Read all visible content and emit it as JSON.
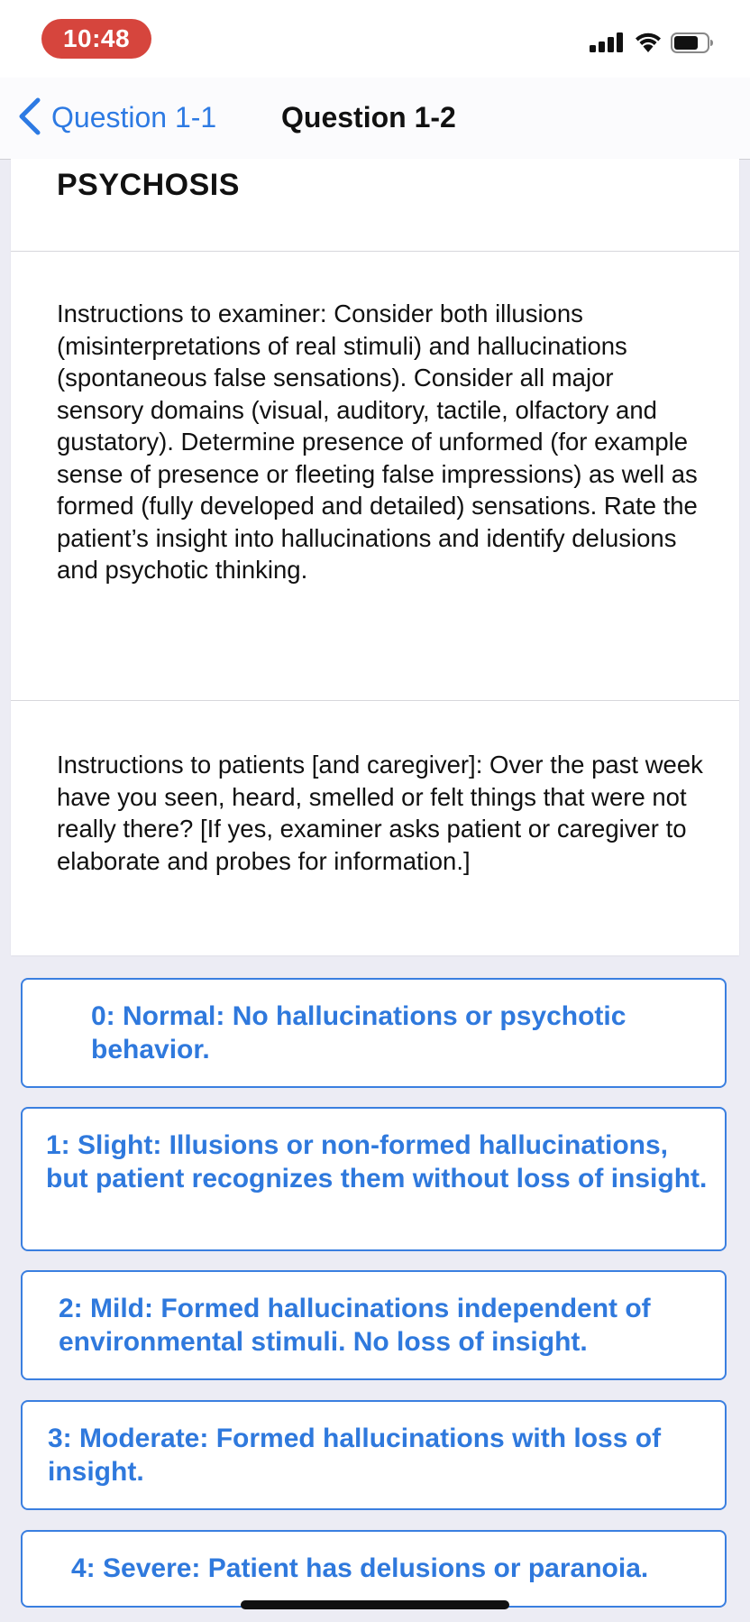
{
  "status_bar": {
    "time": "10:48",
    "icons": [
      "cellular-signal-icon",
      "wifi-icon",
      "battery-icon"
    ]
  },
  "nav": {
    "back_label": "Question 1-1",
    "title": "Question 1-2"
  },
  "content": {
    "section_title": "PSYCHOSIS",
    "examiner_instructions": "Instructions to examiner: Consider both illusions (misinterpretations of real stimuli) and hallucinations (spontaneous false sensations). Consider all major sensory domains (visual, auditory, tactile, olfactory and gustatory). Determine presence of unformed (for example sense of presence or fleeting false impressions) as well as formed (fully developed and detailed) sensations. Rate the patient’s insight into hallucinations and identify delusions and psychotic thinking.",
    "patient_instructions": "Instructions to patients [and caregiver]: Over the past week have you seen, heard, smelled or felt things that were not really there? [If yes, examiner asks patient or caregiver to elaborate and probes for information.]"
  },
  "options": [
    {
      "label": "0: Normal: No hallucinations or psychotic behavior."
    },
    {
      "label": "1: Slight: Illusions or non-formed hallucinations, but patient recognizes them without loss of insight."
    },
    {
      "label": "2: Mild: Formed hallucinations independent of environmental stimuli. No loss of insight."
    },
    {
      "label": "3: Moderate: Formed hallucinations with loss of insight."
    },
    {
      "label": "4: Severe: Patient has delusions or paranoia."
    }
  ],
  "colors": {
    "accent": "#2f79dd",
    "time_pill": "#d6453d",
    "background": "#ececf4"
  }
}
